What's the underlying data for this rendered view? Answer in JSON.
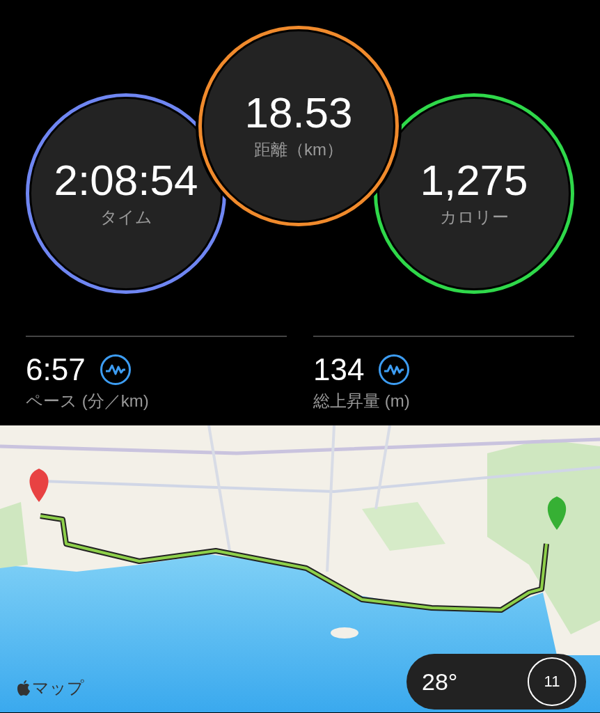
{
  "rings": [
    {
      "value": "2:08:54",
      "label": "タイム",
      "color": "#6f86f2"
    },
    {
      "value": "18.53",
      "label": "距離（km）",
      "color": "#f08a2c"
    },
    {
      "value": "1,275",
      "label": "カロリー",
      "color": "#2fd84a"
    }
  ],
  "stats": [
    {
      "value": "6:57",
      "label": "ペース (分／km)"
    },
    {
      "value": "134",
      "label": "総上昇量 (m)"
    }
  ],
  "map": {
    "kind": "picture",
    "attribution": "マップ",
    "weather": {
      "temperature": "28°",
      "aqi": "11"
    }
  }
}
